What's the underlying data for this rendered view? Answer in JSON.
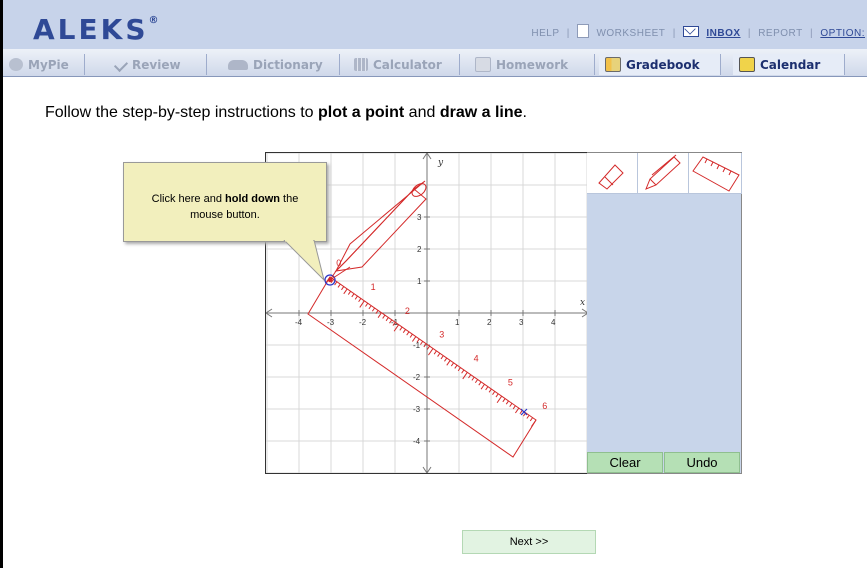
{
  "app": {
    "logo": "ALEKS",
    "logo_mark": "®"
  },
  "toplinks": {
    "help": "HELP",
    "worksheet": "WORKSHEET",
    "inbox": "INBOX",
    "report": "REPORT",
    "options": "OPTION:"
  },
  "tabs": [
    {
      "label": "MyPie",
      "icon": "pie-icon"
    },
    {
      "label": "Review",
      "icon": "check-icon"
    },
    {
      "label": "Dictionary",
      "icon": "book-icon"
    },
    {
      "label": "Calculator",
      "icon": "calculator-icon"
    },
    {
      "label": "Homework",
      "icon": "pencil-paper-icon"
    },
    {
      "label": "Gradebook",
      "icon": "gradebook-icon"
    },
    {
      "label": "Calendar",
      "icon": "calendar-icon"
    }
  ],
  "instructions": {
    "pre": "Follow the step-by-step instructions to ",
    "bold1": "plot a point",
    "mid": " and ",
    "bold2": "draw a line",
    "post": "."
  },
  "callout": {
    "pre": "Click here and ",
    "bold": "hold down",
    "post": " the mouse button."
  },
  "graph": {
    "x_axis_label": "x",
    "y_axis_label": "y",
    "x_ticks": [
      "-4",
      "-3",
      "-2",
      "-1",
      "1",
      "2",
      "3",
      "4"
    ],
    "y_ticks": [
      "3",
      "2",
      "1",
      "-1",
      "-2",
      "-3",
      "-4"
    ],
    "ruler_marks": [
      "0",
      "1",
      "2",
      "3",
      "4",
      "5",
      "6"
    ]
  },
  "tools": {
    "eraser": "eraser-icon",
    "pencil": "pencil-icon",
    "ruler": "ruler-icon",
    "clear": "Clear",
    "undo": "Undo"
  },
  "next_button": "Next >>"
}
